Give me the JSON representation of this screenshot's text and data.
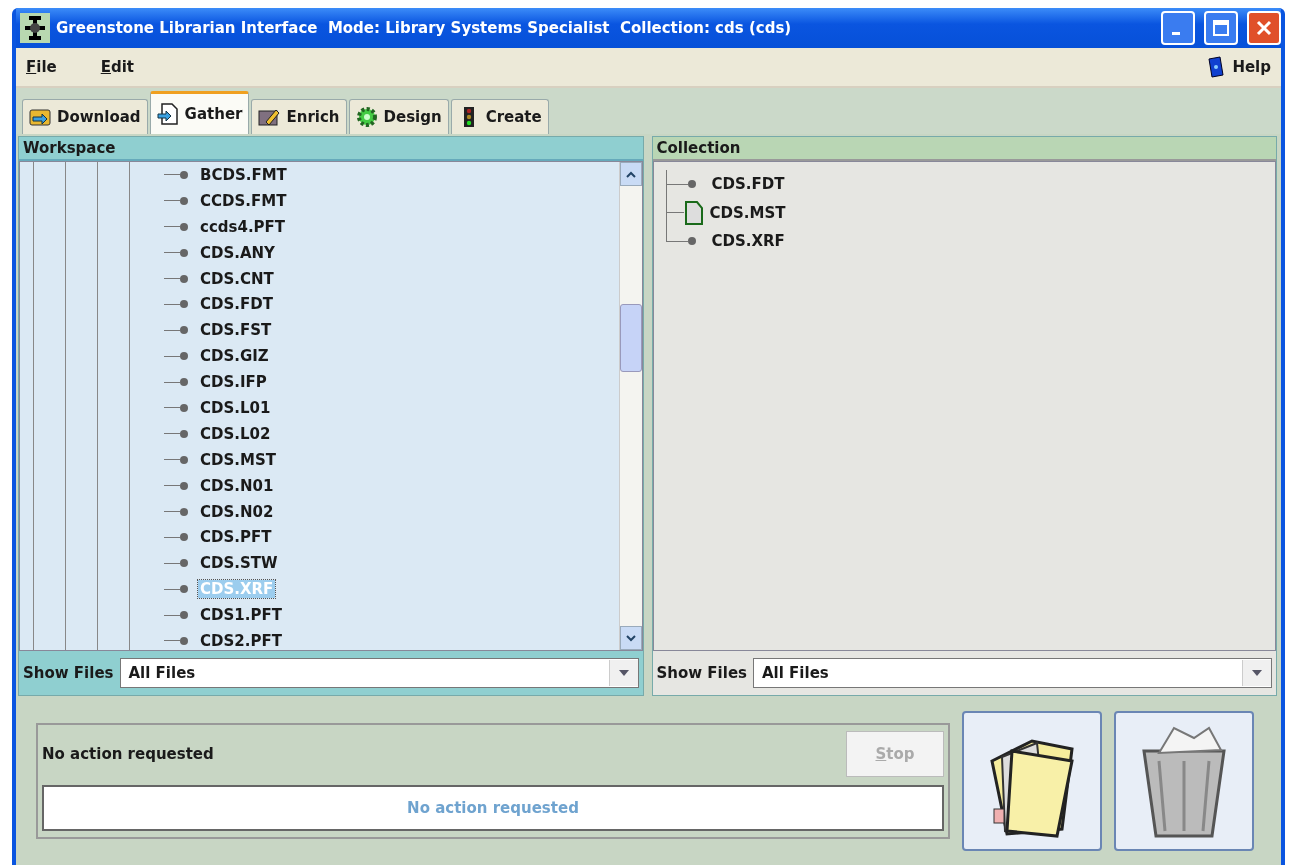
{
  "window": {
    "title": "Greenstone Librarian Interface  Mode: Library Systems Specialist  Collection: cds (cds)"
  },
  "menu": [
    {
      "label": "File"
    },
    {
      "label": "Edit"
    }
  ],
  "help": {
    "label": "Help"
  },
  "tabs": [
    {
      "label": "Download",
      "selected": false
    },
    {
      "label": "Gather",
      "selected": true
    },
    {
      "label": "Enrich",
      "selected": false
    },
    {
      "label": "Design",
      "selected": false
    },
    {
      "label": "Create",
      "selected": false
    }
  ],
  "workspace": {
    "title": "Workspace",
    "items": [
      {
        "name": "BCDS.FMT",
        "selected": false
      },
      {
        "name": "CCDS.FMT",
        "selected": false
      },
      {
        "name": "ccds4.PFT",
        "selected": false
      },
      {
        "name": "CDS.ANY",
        "selected": false
      },
      {
        "name": "CDS.CNT",
        "selected": false
      },
      {
        "name": "CDS.FDT",
        "selected": false
      },
      {
        "name": "CDS.FST",
        "selected": false
      },
      {
        "name": "CDS.GIZ",
        "selected": false
      },
      {
        "name": "CDS.IFP",
        "selected": false
      },
      {
        "name": "CDS.L01",
        "selected": false
      },
      {
        "name": "CDS.L02",
        "selected": false
      },
      {
        "name": "CDS.MST",
        "selected": false
      },
      {
        "name": "CDS.N01",
        "selected": false
      },
      {
        "name": "CDS.N02",
        "selected": false
      },
      {
        "name": "CDS.PFT",
        "selected": false
      },
      {
        "name": "CDS.STW",
        "selected": false
      },
      {
        "name": "CDS.XRF",
        "selected": true
      },
      {
        "name": "CDS1.PFT",
        "selected": false
      },
      {
        "name": "CDS2.PFT",
        "selected": false
      }
    ],
    "filter": {
      "label": "Show Files",
      "value": "All Files"
    }
  },
  "collection": {
    "title": "Collection",
    "items": [
      {
        "name": "CDS.FDT",
        "kind": "leaf"
      },
      {
        "name": "CDS.MST",
        "kind": "file"
      },
      {
        "name": "CDS.XRF",
        "kind": "leaf"
      }
    ],
    "filter": {
      "label": "Show Files",
      "value": "All Files"
    }
  },
  "status": {
    "message": "No action requested",
    "progress_text": "No action requested",
    "level": 0,
    "stop": {
      "label": "Stop",
      "disabled": true
    }
  }
}
